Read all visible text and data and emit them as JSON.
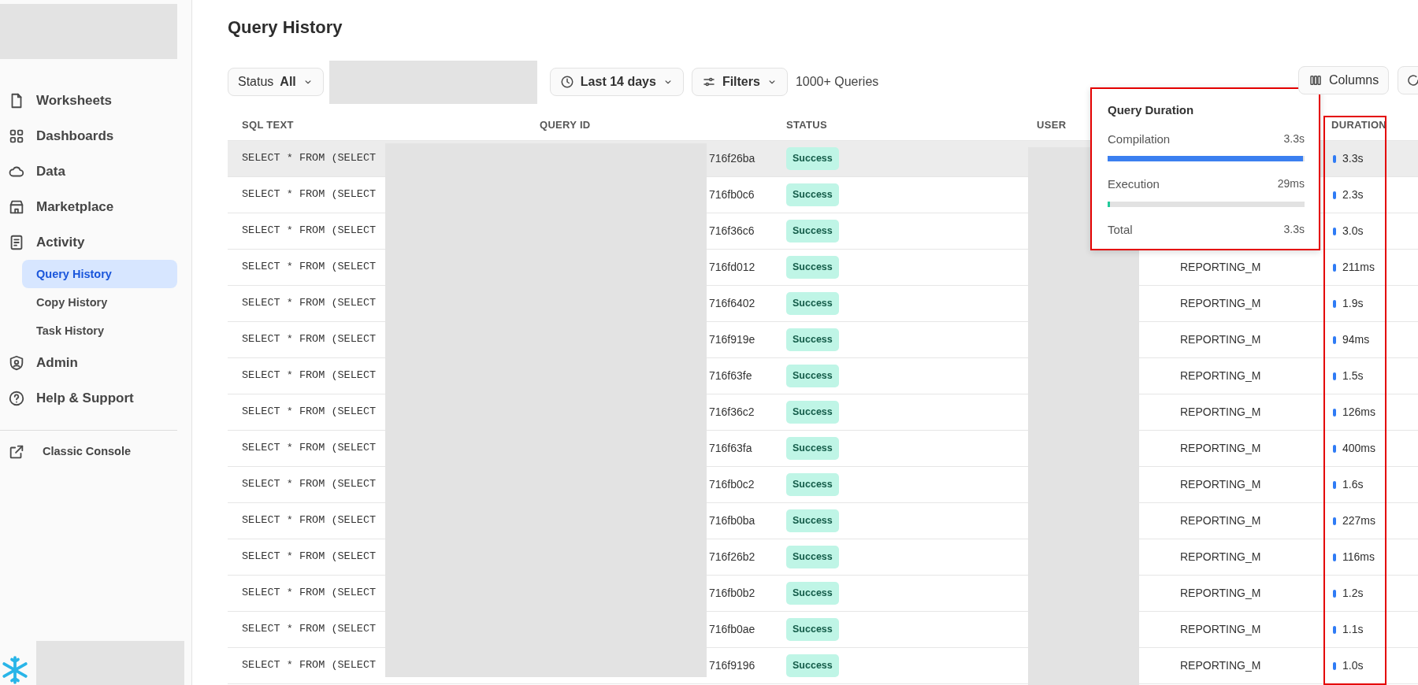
{
  "page_title": "Query History",
  "sidebar": {
    "items": [
      {
        "label": "Worksheets",
        "selected": false
      },
      {
        "label": "Dashboards",
        "selected": false
      },
      {
        "label": "Data",
        "selected": false
      },
      {
        "label": "Marketplace",
        "selected": false
      },
      {
        "label": "Activity",
        "selected": false,
        "children": [
          {
            "label": "Query History",
            "selected": true
          },
          {
            "label": "Copy History",
            "selected": false
          },
          {
            "label": "Task History",
            "selected": false
          }
        ]
      },
      {
        "label": "Admin",
        "selected": false
      },
      {
        "label": "Help & Support",
        "selected": false
      }
    ],
    "footer_link": "Classic Console"
  },
  "toolbar": {
    "status_filter": {
      "label": "Status",
      "value": "All"
    },
    "date_range": "Last 14 days",
    "filters_button": "Filters",
    "query_count": "1000+ Queries",
    "columns_button": "Columns"
  },
  "table": {
    "columns": [
      "SQL TEXT",
      "QUERY ID",
      "STATUS",
      "USER",
      "DURATION"
    ],
    "rows": [
      {
        "sql_text": "SELECT * FROM (SELECT",
        "query_id": "716f26ba",
        "status": "Success",
        "duration": "3.3s",
        "highlighted": true
      },
      {
        "sql_text": "SELECT * FROM (SELECT",
        "query_id": "716fb0c6",
        "status": "Success",
        "duration": "2.3s",
        "highlighted": false
      },
      {
        "sql_text": "SELECT * FROM (SELECT",
        "query_id": "716f36c6",
        "status": "Success",
        "duration": "3.0s",
        "highlighted": false
      },
      {
        "sql_text": "SELECT * FROM (SELECT",
        "query_id": "716fd012",
        "status": "Success",
        "column_5": "REPORTING_M",
        "duration": "211ms",
        "highlighted": false
      },
      {
        "sql_text": "SELECT * FROM (SELECT",
        "query_id": "716f6402",
        "status": "Success",
        "column_5": "REPORTING_M",
        "duration": "1.9s",
        "highlighted": false
      },
      {
        "sql_text": "SELECT * FROM (SELECT",
        "query_id": "716f919e",
        "status": "Success",
        "column_5": "REPORTING_M",
        "duration": "94ms",
        "highlighted": false
      },
      {
        "sql_text": "SELECT * FROM (SELECT",
        "query_id": "716f63fe",
        "status": "Success",
        "column_5": "REPORTING_M",
        "duration": "1.5s",
        "highlighted": false
      },
      {
        "sql_text": "SELECT * FROM (SELECT",
        "query_id": "716f36c2",
        "status": "Success",
        "column_5": "REPORTING_M",
        "duration": "126ms",
        "highlighted": false
      },
      {
        "sql_text": "SELECT * FROM (SELECT",
        "query_id": "716f63fa",
        "status": "Success",
        "column_5": "REPORTING_M",
        "duration": "400ms",
        "highlighted": false
      },
      {
        "sql_text": "SELECT * FROM (SELECT",
        "query_id": "716fb0c2",
        "status": "Success",
        "column_5": "REPORTING_M",
        "duration": "1.6s",
        "highlighted": false
      },
      {
        "sql_text": "SELECT * FROM (SELECT",
        "query_id": "716fb0ba",
        "status": "Success",
        "column_5": "REPORTING_M",
        "duration": "227ms",
        "highlighted": false
      },
      {
        "sql_text": "SELECT * FROM (SELECT",
        "query_id": "716f26b2",
        "status": "Success",
        "column_5": "REPORTING_M",
        "duration": "116ms",
        "highlighted": false
      },
      {
        "sql_text": "SELECT * FROM (SELECT",
        "query_id": "716fb0b2",
        "status": "Success",
        "column_5": "REPORTING_M",
        "duration": "1.2s",
        "highlighted": false
      },
      {
        "sql_text": "SELECT * FROM (SELECT",
        "query_id": "716fb0ae",
        "status": "Success",
        "column_5": "REPORTING_M",
        "duration": "1.1s",
        "highlighted": false
      },
      {
        "sql_text": "SELECT * FROM (SELECT",
        "query_id": "716f9196",
        "status": "Success",
        "column_5": "REPORTING_M",
        "duration": "1.0s",
        "highlighted": false
      }
    ]
  },
  "duration_tooltip": {
    "title": "Query Duration",
    "rows": [
      {
        "kind": "bar",
        "label": "Compilation",
        "value": "3.3s",
        "level": 0.99,
        "color": "#3b7ff0"
      },
      {
        "kind": "bar",
        "label": "Execution",
        "value": "29ms",
        "level": 0.01,
        "color": "#22c99a"
      },
      {
        "kind": "total",
        "label": "Total",
        "value": "3.3s"
      }
    ]
  }
}
